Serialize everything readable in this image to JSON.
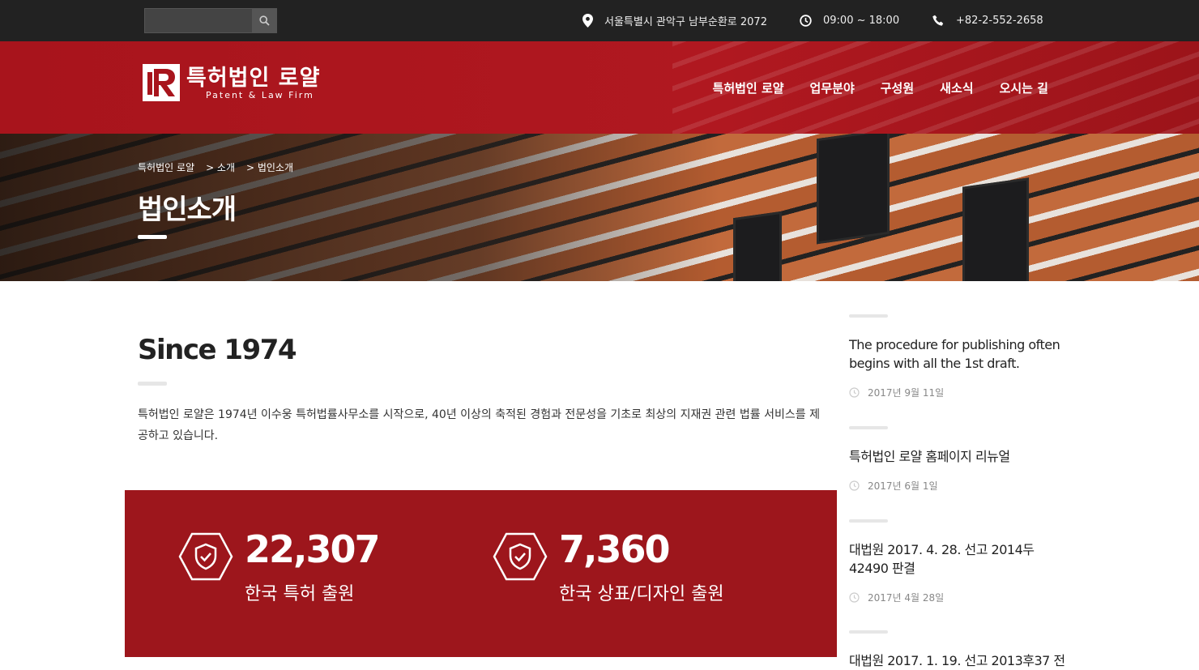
{
  "topbar": {
    "search_placeholder": "",
    "address": "서울특별시 관악구 남부순환로 2072",
    "hours": "09:00 ~ 18:00",
    "phone": "+82-2-552-2658"
  },
  "header": {
    "logo_name": "특허법인 로얄",
    "logo_sub": "Patent & Law Firm",
    "nav": [
      "특허법인 로얄",
      "업무분야",
      "구성원",
      "새소식",
      "오시는 길"
    ]
  },
  "banner": {
    "breadcrumb": [
      "특허법인 로얄",
      "> 소개",
      "> 법인소개"
    ],
    "title": "법인소개"
  },
  "main": {
    "since_title": "Since 1974",
    "intro": "특허법인 로얄은 1974년 이수웅 특허법률사무소를 시작으로, 40년 이상의 축적된 경험과 전문성을 기초로 최상의 지재권 관련 법률 서비스를 제공하고 있습니다.",
    "stats": [
      {
        "number": "22,307",
        "label": "한국 특허 출원",
        "icon": "shield-check-icon"
      },
      {
        "number": "7,360",
        "label": "한국 상표/디자인 출원",
        "icon": "shield-check-icon"
      }
    ]
  },
  "sidebar": {
    "posts": [
      {
        "title": "The procedure for publishing often begins with all the 1st draft.",
        "date": "2017년 9월 11일"
      },
      {
        "title": "특허법인 로얄 홈페이지 리뉴얼",
        "date": "2017년 6월 1일"
      },
      {
        "title": "대법원 2017. 4. 28. 선고 2014두 42490 판결",
        "date": "2017년 4월 28일"
      },
      {
        "title": "대법원 2017. 1. 19. 선고 2013후37 전",
        "date": ""
      }
    ]
  },
  "colors": {
    "brand_red": "#9d161c",
    "topbar": "#222222"
  }
}
